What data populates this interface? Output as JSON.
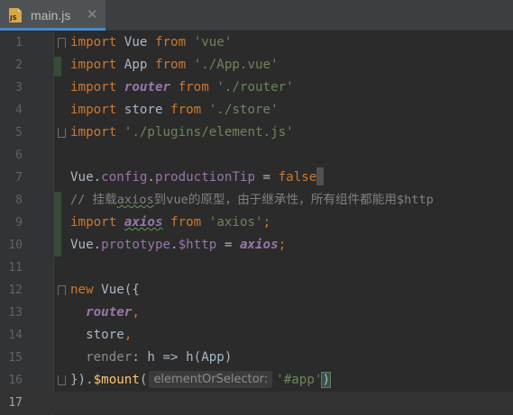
{
  "tab": {
    "icon": "js-file-icon",
    "icon_text": "JS",
    "label": "main.js",
    "close": "✕"
  },
  "line_numbers": [
    "1",
    "2",
    "3",
    "4",
    "5",
    "6",
    "7",
    "8",
    "9",
    "10",
    "11",
    "12",
    "13",
    "14",
    "15",
    "16",
    "17"
  ],
  "code": {
    "l1": {
      "kw": "import",
      "name": " Vue ",
      "from": "from",
      "str": "'vue'"
    },
    "l2": {
      "kw": "import",
      "name": " App ",
      "from": "from",
      "str": "'./App.vue'"
    },
    "l3": {
      "kw": "import",
      "name": "router",
      "from": "from",
      "str": "'./router'"
    },
    "l4": {
      "kw": "import",
      "name": " store ",
      "from": "from",
      "str": "'./store'"
    },
    "l5": {
      "kw": "import",
      "str": "'./plugins/element.js'"
    },
    "l7": {
      "obj": "Vue",
      "dot1": ".",
      "p1": "config",
      "dot2": ".",
      "p2": "productionTip",
      "eq": " = ",
      "val": "false"
    },
    "l8": {
      "pre": "// 挂载",
      "axios": "axios",
      "post": "到vue的原型，由于继承性，所有组件都能用$http"
    },
    "l9": {
      "kw": "import",
      "name": "axios",
      "from": "from",
      "str": "'axios'",
      "semi": ";"
    },
    "l10": {
      "obj": "Vue",
      "dot1": ".",
      "p1": "prototype",
      "dot2": ".",
      "p2": "$http",
      "eq": " = ",
      "val": "axios",
      "semi": ";"
    },
    "l12": {
      "kw": "new",
      "rest": " Vue({"
    },
    "l13": {
      "name": "router",
      "comma": ","
    },
    "l14": {
      "name": "store",
      "comma": ","
    },
    "l15": {
      "key": "render",
      "rest": ": h => h(App)"
    },
    "l16": {
      "close": "})",
      "dot": ".",
      "fn": "$mount",
      "open": "(",
      "hint": "elementOrSelector:",
      "str": "'#app'",
      "end": ")"
    }
  },
  "colors": {
    "background": "#2b2b2b",
    "keyword": "#cc7832",
    "string": "#6a8759",
    "field": "#9876aa",
    "comment": "#808080",
    "function": "#ffc66d"
  }
}
